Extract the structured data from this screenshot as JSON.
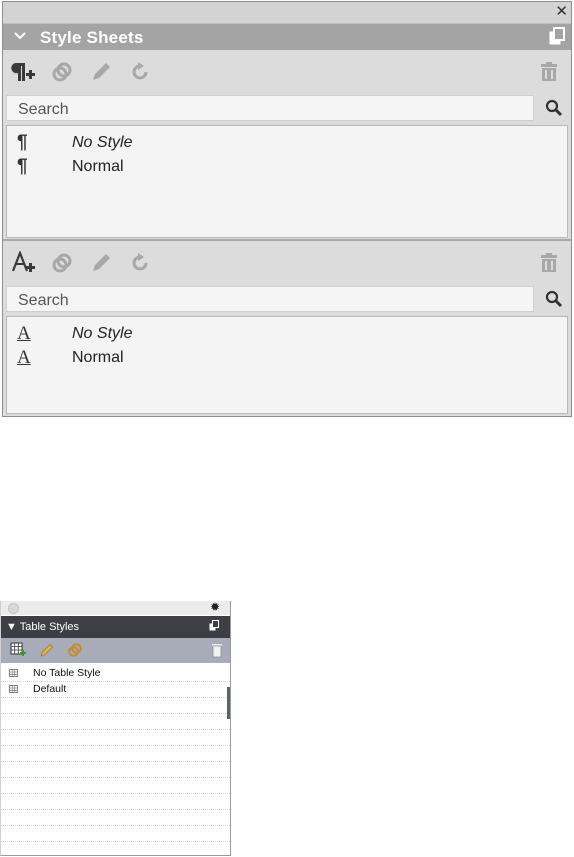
{
  "style_sheets": {
    "title": "Style Sheets",
    "paragraph": {
      "search_placeholder": "Search",
      "items": [
        {
          "icon": "¶",
          "label": "No Style",
          "italic": true
        },
        {
          "icon": "¶",
          "label": "Normal",
          "italic": false
        }
      ]
    },
    "character": {
      "search_placeholder": "Search",
      "items": [
        {
          "icon": "A",
          "label": "No Style",
          "italic": true
        },
        {
          "icon": "A",
          "label": "Normal",
          "italic": false
        }
      ]
    }
  },
  "table_styles": {
    "title": "▼ Table Styles",
    "items": [
      {
        "label": "No Table Style"
      },
      {
        "label": "Default"
      }
    ]
  }
}
